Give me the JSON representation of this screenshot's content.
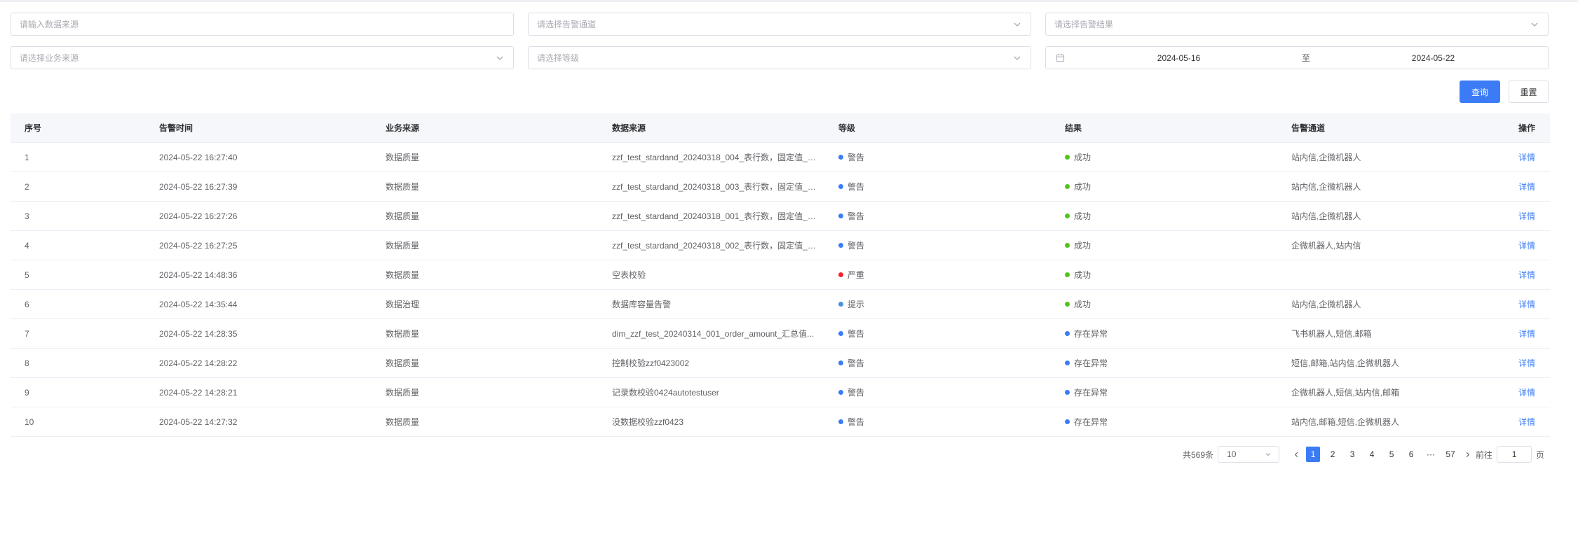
{
  "filters": {
    "data_source_placeholder": "请输入数据来源",
    "channel_placeholder": "请选择告警通道",
    "result_placeholder": "请选择告警结果",
    "business_source_placeholder": "请选择业务来源",
    "level_placeholder": "请选择等级",
    "date_start": "2024-05-16",
    "date_separator": "至",
    "date_end": "2024-05-22"
  },
  "actions": {
    "query_label": "查询",
    "reset_label": "重置"
  },
  "table": {
    "headers": [
      "序号",
      "告警时间",
      "业务来源",
      "数据来源",
      "等级",
      "结果",
      "告警通道",
      "操作"
    ],
    "rows": [
      {
        "no": "1",
        "time": "2024-05-22 16:27:40",
        "business": "数据质量",
        "source": "zzf_test_stardand_20240318_004_表行数，固定值_2...",
        "level": "警告",
        "level_color": "#3b7cf6",
        "result": "成功",
        "result_color": "#52c41a",
        "channel": "站内信,企微机器人",
        "op": "详情"
      },
      {
        "no": "2",
        "time": "2024-05-22 16:27:39",
        "business": "数据质量",
        "source": "zzf_test_stardand_20240318_003_表行数，固定值_2...",
        "level": "警告",
        "level_color": "#3b7cf6",
        "result": "成功",
        "result_color": "#52c41a",
        "channel": "站内信,企微机器人",
        "op": "详情"
      },
      {
        "no": "3",
        "time": "2024-05-22 16:27:26",
        "business": "数据质量",
        "source": "zzf_test_stardand_20240318_001_表行数，固定值_2...",
        "level": "警告",
        "level_color": "#3b7cf6",
        "result": "成功",
        "result_color": "#52c41a",
        "channel": "站内信,企微机器人",
        "op": "详情"
      },
      {
        "no": "4",
        "time": "2024-05-22 16:27:25",
        "business": "数据质量",
        "source": "zzf_test_stardand_20240318_002_表行数，固定值_2...",
        "level": "警告",
        "level_color": "#3b7cf6",
        "result": "成功",
        "result_color": "#52c41a",
        "channel": "企微机器人,站内信",
        "op": "详情"
      },
      {
        "no": "5",
        "time": "2024-05-22 14:48:36",
        "business": "数据质量",
        "source": "空表校验",
        "level": "严重",
        "level_color": "#f5222d",
        "result": "成功",
        "result_color": "#52c41a",
        "channel": "",
        "op": "详情"
      },
      {
        "no": "6",
        "time": "2024-05-22 14:35:44",
        "business": "数据治理",
        "source": "数据库容量告警",
        "level": "提示",
        "level_color": "#4a90e2",
        "result": "成功",
        "result_color": "#52c41a",
        "channel": "站内信,企微机器人",
        "op": "详情"
      },
      {
        "no": "7",
        "time": "2024-05-22 14:28:35",
        "business": "数据质量",
        "source": "dim_zzf_test_20240314_001_order_amount_汇总值...",
        "level": "警告",
        "level_color": "#3b7cf6",
        "result": "存在异常",
        "result_color": "#3b7cf6",
        "channel": "飞书机器人,短信,邮箱",
        "op": "详情"
      },
      {
        "no": "8",
        "time": "2024-05-22 14:28:22",
        "business": "数据质量",
        "source": "控制校验zzf0423002",
        "level": "警告",
        "level_color": "#3b7cf6",
        "result": "存在异常",
        "result_color": "#3b7cf6",
        "channel": "短信,邮箱,站内信,企微机器人",
        "op": "详情"
      },
      {
        "no": "9",
        "time": "2024-05-22 14:28:21",
        "business": "数据质量",
        "source": "记录数校验0424autotestuser",
        "level": "警告",
        "level_color": "#3b7cf6",
        "result": "存在异常",
        "result_color": "#3b7cf6",
        "channel": "企微机器人,短信,站内信,邮箱",
        "op": "详情"
      },
      {
        "no": "10",
        "time": "2024-05-22 14:27:32",
        "business": "数据质量",
        "source": "没数据校验zzf0423",
        "level": "警告",
        "level_color": "#3b7cf6",
        "result": "存在异常",
        "result_color": "#3b7cf6",
        "channel": "站内信,邮箱,短信,企微机器人",
        "op": "详情"
      }
    ]
  },
  "pagination": {
    "total_label": "共569条",
    "page_size": "10",
    "pages": [
      "1",
      "2",
      "3",
      "4",
      "5",
      "6"
    ],
    "ellipsis": "···",
    "last_page": "57",
    "goto_label": "前往",
    "goto_value": "1",
    "page_suffix": "页"
  },
  "colors": {
    "primary": "#3b7cf6",
    "success": "#52c41a",
    "danger": "#f5222d"
  }
}
